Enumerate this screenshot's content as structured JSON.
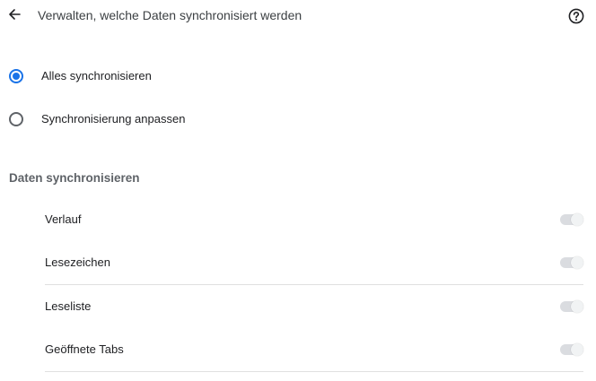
{
  "header": {
    "title": "Verwalten, welche Daten synchronisiert werden",
    "back_icon": "arrow-left-icon",
    "help_icon": "help-circle-icon"
  },
  "sync_mode": {
    "options": [
      {
        "label": "Alles synchronisieren",
        "selected": true
      },
      {
        "label": "Synchronisierung anpassen",
        "selected": false
      }
    ]
  },
  "data_section": {
    "title": "Daten synchronisieren",
    "items": [
      {
        "label": "Verlauf",
        "enabled": true,
        "disabled": true
      },
      {
        "label": "Lesezeichen",
        "enabled": true,
        "disabled": true
      },
      {
        "label": "Leseliste",
        "enabled": true,
        "disabled": true
      },
      {
        "label": "Geöffnete Tabs",
        "enabled": true,
        "disabled": true
      }
    ]
  },
  "colors": {
    "accent": "#1a73e8",
    "toggle_disabled": "#dadce0",
    "divider": "#e0e0e0"
  }
}
